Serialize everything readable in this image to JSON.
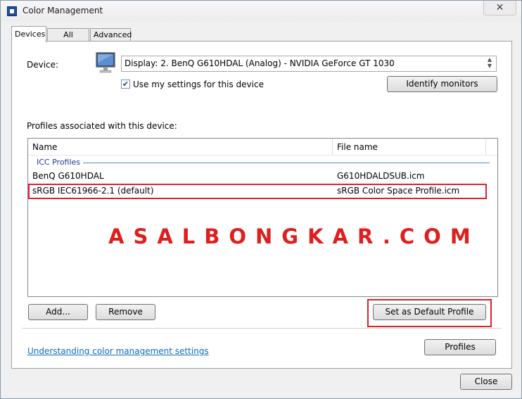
{
  "window": {
    "title": "Color Management",
    "close_symbol": "✕"
  },
  "tabs": [
    {
      "label": "Devices",
      "active": true
    },
    {
      "label": "All Profiles",
      "active": false
    },
    {
      "label": "Advanced",
      "active": false
    }
  ],
  "device": {
    "label": "Device:",
    "selected": "Display: 2. BenQ G610HDAL (Analog) - NVIDIA GeForce GT 1030",
    "use_settings_label": "Use my settings for this device",
    "use_settings_checked": true,
    "identify_button": "Identify monitors"
  },
  "profiles": {
    "section_label": "Profiles associated with this device:",
    "columns": [
      "Name",
      "File name"
    ],
    "group": "ICC Profiles",
    "rows": [
      {
        "name": "BenQ G610HDAL",
        "file": "G610HDALDSUB.icm"
      },
      {
        "name": "sRGB IEC61966-2.1 (default)",
        "file": "sRGB Color Space Profile.icm"
      }
    ]
  },
  "watermark": "ASALBONGKAR.COM",
  "buttons": {
    "add": "Add...",
    "remove": "Remove",
    "set_default": "Set as Default Profile",
    "profiles": "Profiles",
    "close": "Close"
  },
  "help_link": "Understanding color management settings",
  "colors": {
    "highlight": "#d9232a",
    "watermark": "#e01e1e",
    "link": "#0b6bbf"
  }
}
